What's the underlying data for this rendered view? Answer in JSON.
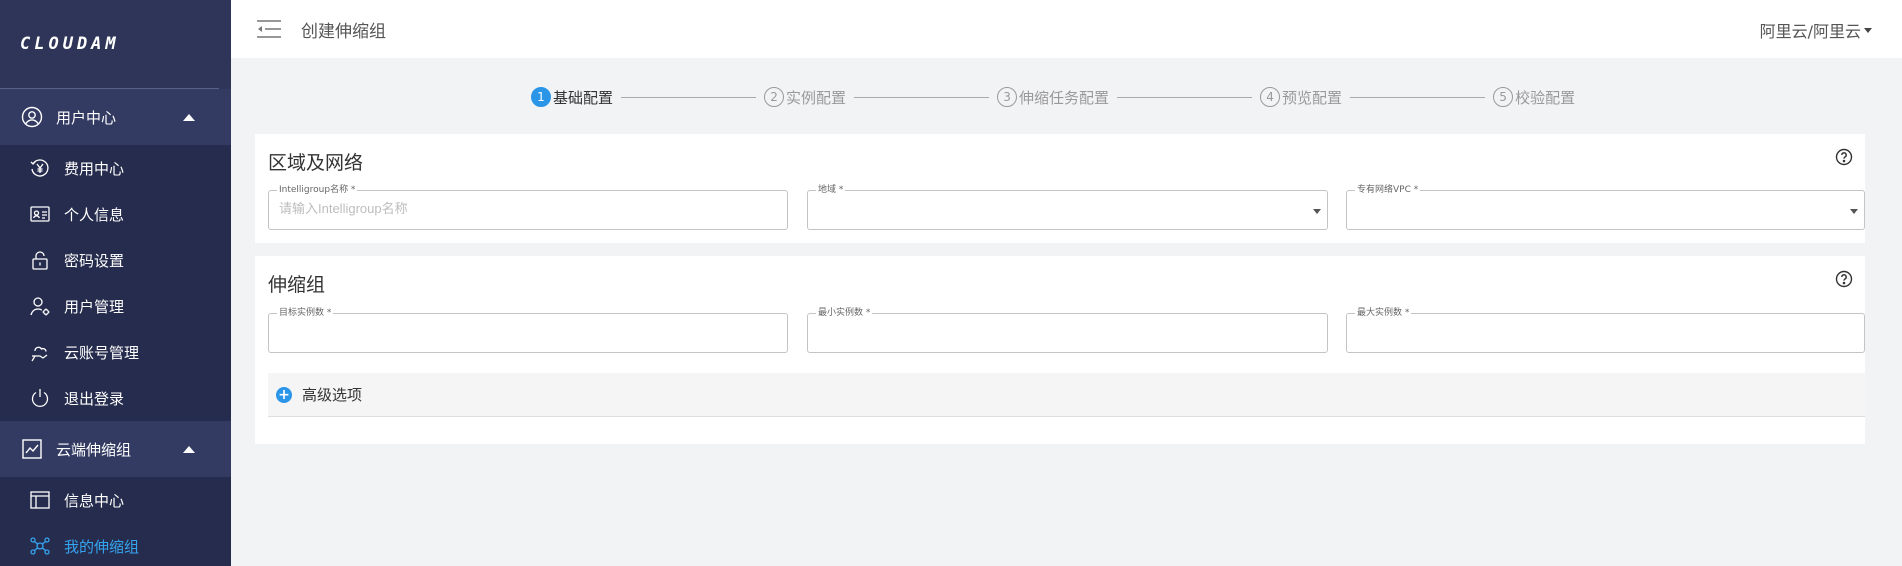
{
  "sidebar": {
    "logo": "CLOUDAM",
    "groups": [
      {
        "label": "用户中心",
        "icon": "user-circle-icon",
        "items": [
          {
            "label": "费用中心",
            "icon": "yen-coin-icon"
          },
          {
            "label": "个人信息",
            "icon": "id-card-icon"
          },
          {
            "label": "密码设置",
            "icon": "lock-icon"
          },
          {
            "label": "用户管理",
            "icon": "user-settings-icon"
          },
          {
            "label": "云账号管理",
            "icon": "cloud-hand-icon"
          },
          {
            "label": "退出登录",
            "icon": "power-icon"
          }
        ]
      },
      {
        "label": "云端伸缩组",
        "icon": "line-chart-icon",
        "items": [
          {
            "label": "信息中心",
            "icon": "layout-icon"
          },
          {
            "label": "我的伸缩组",
            "icon": "cluster-icon",
            "active": true
          }
        ]
      }
    ]
  },
  "header": {
    "title": "创建伸缩组",
    "account": "阿里云/阿里云"
  },
  "stepper": {
    "steps": [
      {
        "num": "1",
        "label": "基础配置",
        "active": true
      },
      {
        "num": "2",
        "label": "实例配置"
      },
      {
        "num": "3",
        "label": "伸缩任务配置"
      },
      {
        "num": "4",
        "label": "预览配置"
      },
      {
        "num": "5",
        "label": "校验配置"
      }
    ]
  },
  "region_card": {
    "title": "区域及网络",
    "fields": [
      {
        "label": "Intelligroup名称 *",
        "placeholder": "请输入Intelligroup名称",
        "value": ""
      },
      {
        "label": "地域 *",
        "value": ""
      },
      {
        "label": "专有网络VPC *",
        "value": ""
      }
    ]
  },
  "scaling_card": {
    "title": "伸缩组",
    "fields": [
      {
        "label": "目标实例数 *",
        "value": ""
      },
      {
        "label": "最小实例数 *",
        "value": ""
      },
      {
        "label": "最大实例数 *",
        "value": ""
      }
    ],
    "advanced": "高级选项"
  },
  "colors": {
    "sidebar_bg": "#2e3559",
    "sidebar_sub_bg": "#262c4d",
    "accent": "#2b95e8",
    "active_text": "#35a4f0"
  }
}
